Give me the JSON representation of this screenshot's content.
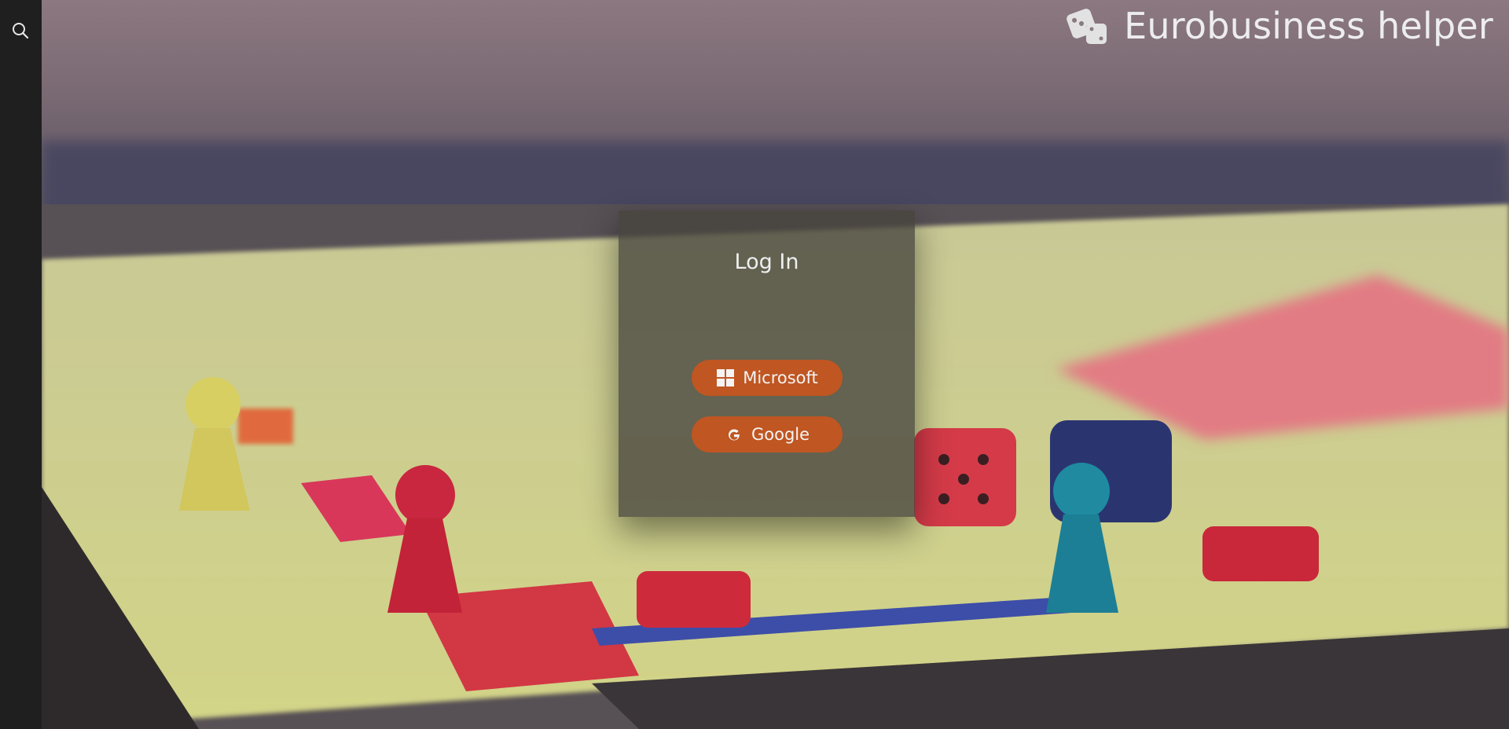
{
  "app": {
    "title": "Eurobusiness helper",
    "logo_icon": "dice-icon"
  },
  "sidebar": {
    "search_icon": "search-icon"
  },
  "login": {
    "title": "Log In",
    "providers": [
      {
        "label": "Microsoft",
        "icon": "windows-icon"
      },
      {
        "label": "Google",
        "icon": "google-icon"
      }
    ]
  },
  "colors": {
    "sidebar_bg": "#1f1f1f",
    "card_bg": "#46443e",
    "button_bg": "#c05622",
    "text_light": "#efefef"
  }
}
